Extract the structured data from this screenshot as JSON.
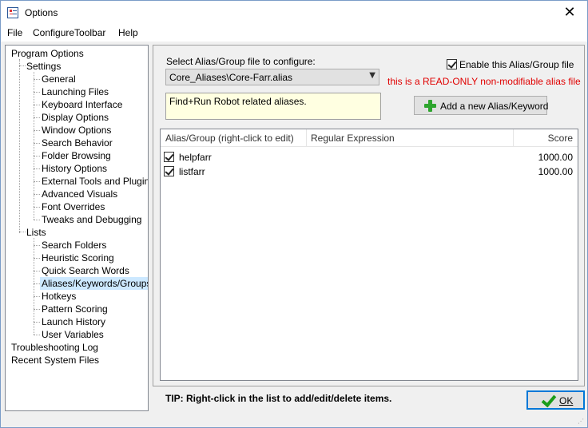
{
  "window": {
    "title": "Options"
  },
  "menu": [
    "File",
    "ConfigureToolbar",
    "Help"
  ],
  "tree": {
    "program_options": "Program Options",
    "settings": "Settings",
    "settings_children": [
      "General",
      "Launching Files",
      "Keyboard Interface",
      "Display Options",
      "Window Options",
      "Search Behavior",
      "Folder Browsing",
      "History Options",
      "External Tools and Plugins",
      "Advanced Visuals",
      "Font Overrides",
      "Tweaks and Debugging"
    ],
    "lists": "Lists",
    "lists_children": [
      "Search Folders",
      "Heuristic Scoring",
      "Quick Search Words",
      "Aliases/Keywords/Groups",
      "Hotkeys",
      "Pattern Scoring",
      "Launch History",
      "User Variables"
    ],
    "selected": "Aliases/Keywords/Groups",
    "troubleshooting": "Troubleshooting Log",
    "recent": "Recent System Files"
  },
  "config": {
    "select_label": "Select Alias/Group file to configure:",
    "file_value": "Core_Aliases\\Core-Farr.alias",
    "enable_label": "Enable this Alias/Group file",
    "enable_checked": true,
    "readonly_notice": "this is a READ-ONLY non-modifiable alias file",
    "description": "Find+Run Robot related aliases.",
    "add_button": "Add a new Alias/Keyword"
  },
  "list": {
    "columns": [
      "Alias/Group (right-click to edit)",
      "Regular Expression",
      "Score"
    ],
    "rows": [
      {
        "name": "helpfarr",
        "regex": "",
        "score": "1000.00",
        "checked": true
      },
      {
        "name": "listfarr",
        "regex": "",
        "score": "1000.00",
        "checked": true
      }
    ]
  },
  "footer": {
    "tip": "TIP: Right-click in the list to add/edit/delete items.",
    "ok": "OK"
  },
  "colors": {
    "readonly": "#e00000",
    "selected_bg": "#cce8ff",
    "desc_bg": "#ffffe1",
    "accent": "#0078d7"
  }
}
